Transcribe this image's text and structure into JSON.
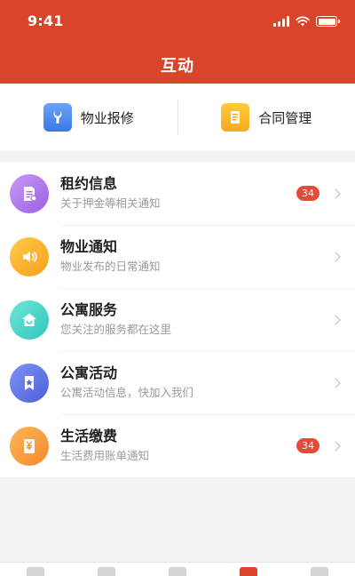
{
  "status_bar": {
    "time": "9:41"
  },
  "header": {
    "title": "互动"
  },
  "quick_actions": [
    {
      "label": "物业报修",
      "icon": "wrench-icon"
    },
    {
      "label": "合同管理",
      "icon": "contract-icon"
    }
  ],
  "list": [
    {
      "title": "租约信息",
      "subtitle": "关于押金等相关通知",
      "badge": "34",
      "icon": "document-icon"
    },
    {
      "title": "物业通知",
      "subtitle": "物业发布的日常通知",
      "badge": null,
      "icon": "speaker-icon"
    },
    {
      "title": "公寓服务",
      "subtitle": "您关注的服务都在这里",
      "badge": null,
      "icon": "home-icon"
    },
    {
      "title": "公寓活动",
      "subtitle": "公寓活动信息，快加入我们",
      "badge": null,
      "icon": "star-bookmark-icon"
    },
    {
      "title": "生活缴费",
      "subtitle": "生活费用账单通知",
      "badge": "34",
      "icon": "yen-bill-icon"
    }
  ],
  "colors": {
    "accent": "#d9452b",
    "badge": "#e24a3b"
  }
}
